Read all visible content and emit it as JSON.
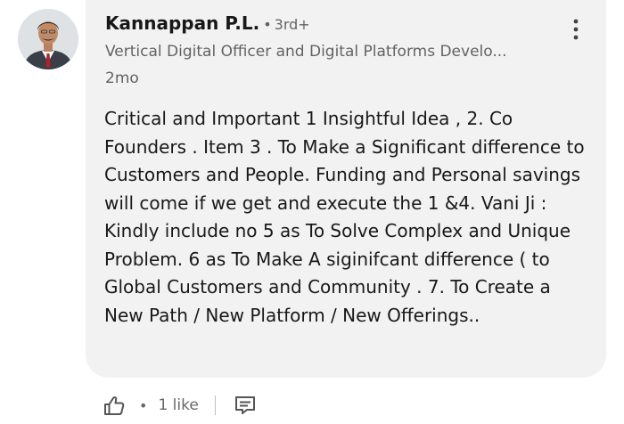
{
  "author": {
    "name": "Kannappan P.L.",
    "separator": "•",
    "degree": "3rd+",
    "headline": "Vertical Digital Officer and Digital Platforms Develo...",
    "time": "2mo"
  },
  "comment": {
    "text": "Critical and Important 1 Insightful Idea , 2. Co Founders . Item 3 . To Make a Significant difference to Customers and People.  Funding and Personal savings will come if we get and execute the 1 &4. Vani Ji : Kindly include no 5 as To Solve Complex and Unique Problem. 6 as To Make A siginifcant difference ( to Global Customers and Community . 7. To Create a New Path / New Platform / New Offerings.."
  },
  "actions": {
    "separator": "•",
    "like_count": "1 like"
  },
  "icons": {
    "avatar": "profile-photo",
    "more": "more-vertical-icon",
    "like": "thumbs-up-icon",
    "reply": "comment-icon"
  },
  "colors": {
    "bubble": "#f2f2f2",
    "text_primary": "#1a1a1a",
    "text_secondary": "#666666"
  }
}
